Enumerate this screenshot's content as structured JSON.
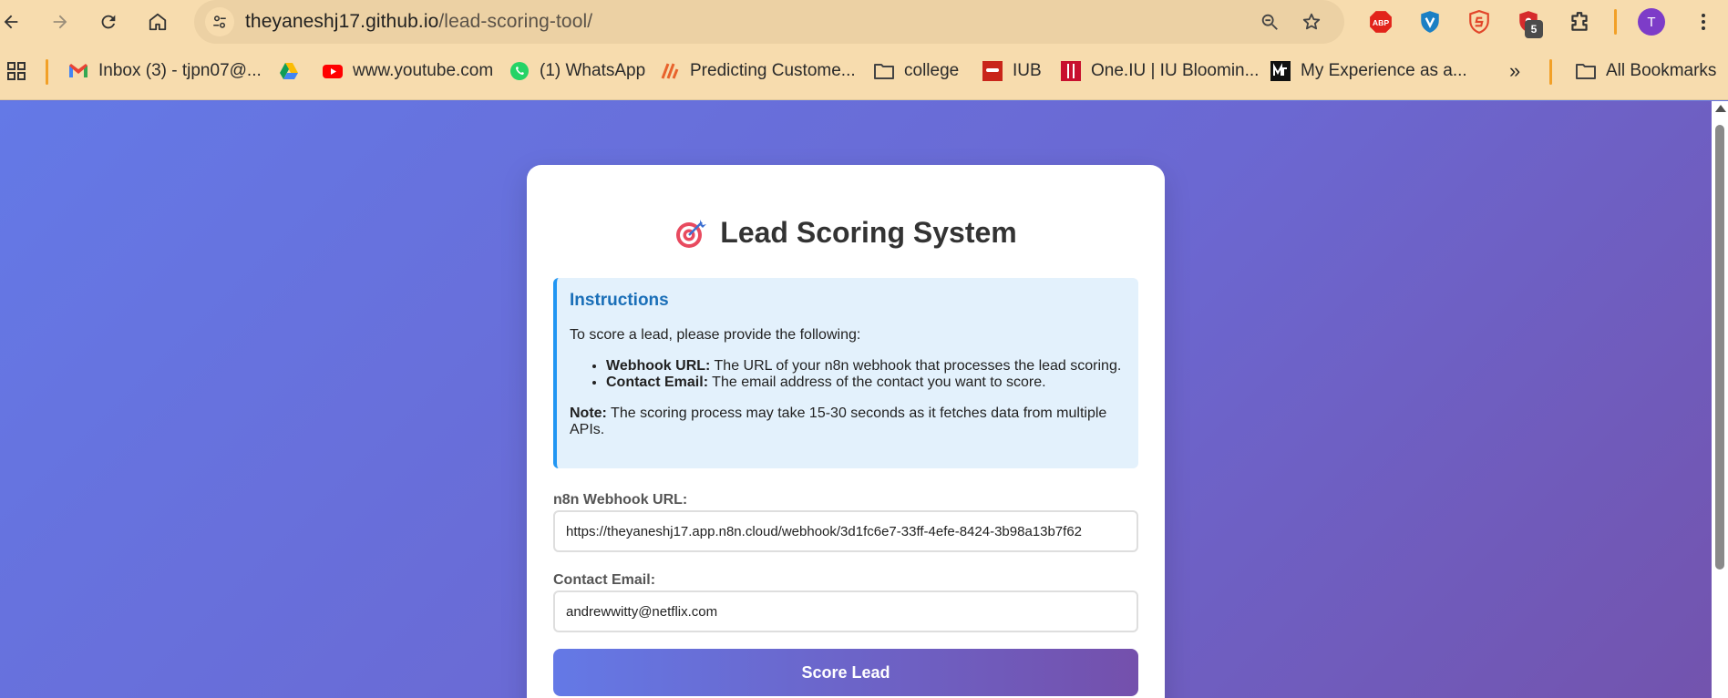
{
  "browser": {
    "url_host": "theyaneshj17.github.io",
    "url_path": "/lead-scoring-tool/",
    "extension_badge": "5",
    "profile_initial": "T",
    "extension_abp_label": "ABP"
  },
  "bookmarks": [
    {
      "label": "Inbox (3) - tjpn07@...",
      "icon": "gmail-icon"
    },
    {
      "label": "",
      "icon": "google-drive-icon"
    },
    {
      "label": "www.youtube.com",
      "icon": "youtube-icon"
    },
    {
      "label": "(1) WhatsApp",
      "icon": "whatsapp-icon"
    },
    {
      "label": "Predicting Custome...",
      "icon": "kaggle-icon"
    },
    {
      "label": "college",
      "icon": "folder-icon"
    },
    {
      "label": "IUB",
      "icon": "oracle-icon"
    },
    {
      "label": "One.IU | IU Bloomin...",
      "icon": "iu-icon"
    },
    {
      "label": "My Experience as a...",
      "icon": "medium-icon"
    }
  ],
  "bookmarks_overflow": "»",
  "all_bookmarks": "All Bookmarks",
  "page": {
    "title": "Lead Scoring System",
    "instructions": {
      "heading": "Instructions",
      "intro": "To score a lead, please provide the following:",
      "items": [
        {
          "term": "Webhook URL:",
          "text": " The URL of your n8n webhook that processes the lead scoring."
        },
        {
          "term": "Contact Email:",
          "text": " The email address of the contact you want to score."
        }
      ],
      "note_term": "Note:",
      "note_text": " The scoring process may take 15-30 seconds as it fetches data from multiple APIs."
    },
    "webhook_label": "n8n Webhook URL:",
    "webhook_value": "https://theyaneshj17.app.n8n.cloud/webhook/3d1fc6e7-33ff-4efe-8424-3b98a13b7f62",
    "email_label": "Contact Email:",
    "email_value": "andrewwitty@netflix.com",
    "submit_label": "Score Lead"
  },
  "colors": {
    "chrome_bg": "#f7dcae",
    "accent_blue": "#2196f3",
    "gradient_start": "#6479e6",
    "gradient_end": "#7450ac"
  }
}
